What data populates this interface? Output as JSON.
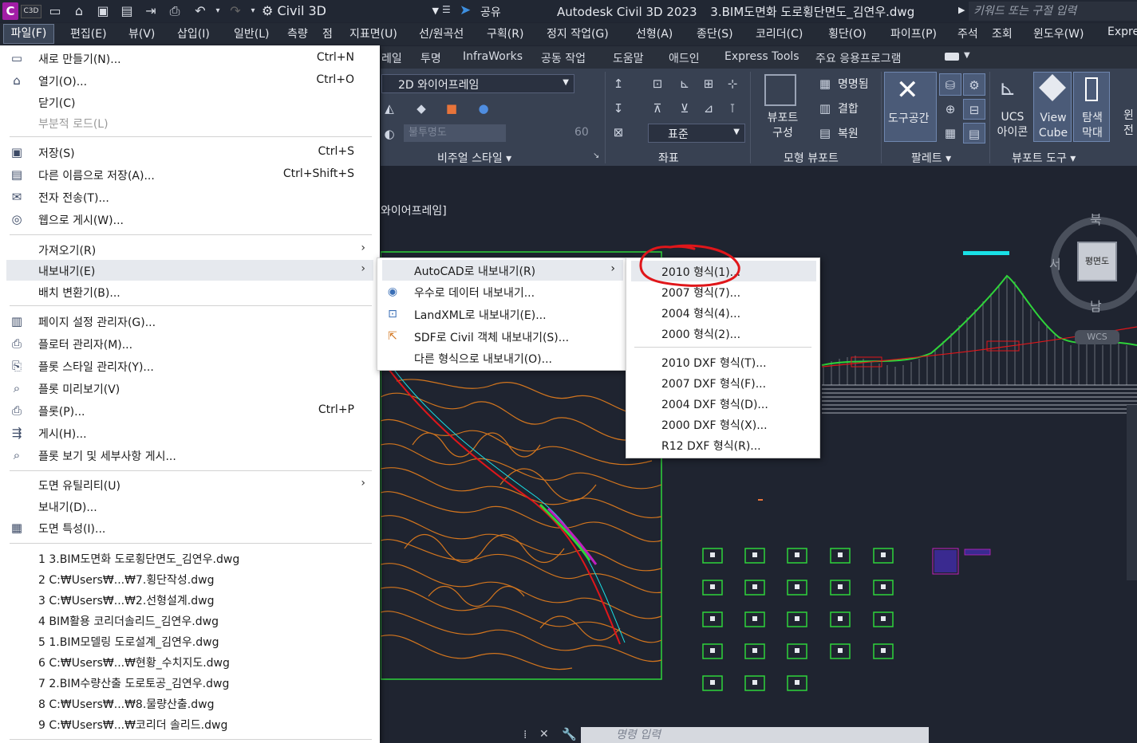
{
  "titlebar": {
    "app_badge": "C",
    "c3d_badge": "C3D",
    "workspace": "Civil 3D",
    "share": "공유",
    "title": "Autodesk Civil 3D 2023",
    "filename": "3.BIM도면화 도로횡단면도_김연우.dwg",
    "search_placeholder": "키워드 또는 구절 입력"
  },
  "menubar": [
    "파일(F)",
    "편집(E)",
    "뷰(V)",
    "삽입(I)",
    "일반(L)",
    "측량",
    "점",
    "지표면(U)",
    "선/원곡선",
    "구획(R)",
    "정지 작업(G)",
    "선형(A)",
    "종단(S)",
    "코리더(C)",
    "횡단(O)",
    "파이프(P)",
    "주석",
    "조회",
    "윈도우(W)",
    "Expre"
  ],
  "ribbon_tabs": [
    "레일",
    "투명",
    "InfraWorks",
    "공동 작업",
    "도움말",
    "애드인",
    "Express Tools",
    "주요 응용프로그램"
  ],
  "ribbon": {
    "visual_style_value": "2D 와이어프레임",
    "transparency_label": "불투명도",
    "transparency_value": "60",
    "coord_value": "표준",
    "viewport_config": "뷰포트 구성",
    "named": "명명됨",
    "join": "결합",
    "restore": "복원",
    "tool_space": "도구공간",
    "ucs_icon": "UCS 아이콘",
    "view_cube": "View Cube",
    "nav_bar": "탐색 막대",
    "win_cut": "윈 전",
    "panels": [
      "비주얼 스타일",
      "좌표",
      "모형 뷰포트",
      "팔레트",
      "뷰포트 도구"
    ]
  },
  "drawing": {
    "viewport_label": "와이어프레임]",
    "compass": {
      "north": "북",
      "west": "서",
      "south": "남",
      "top": "평면도",
      "wcs": "WCS"
    }
  },
  "file_menu": {
    "items": [
      {
        "label": "새로 만들기(N)...",
        "shortcut": "Ctrl+N",
        "icon": "new-icon"
      },
      {
        "label": "열기(O)...",
        "shortcut": "Ctrl+O",
        "icon": "open-icon"
      },
      {
        "label": "닫기(C)",
        "shortcut": "",
        "icon": ""
      },
      {
        "label": "부분적 로드(L)",
        "shortcut": "",
        "icon": "",
        "disabled": true
      },
      {
        "label": "저장(S)",
        "shortcut": "Ctrl+S",
        "icon": "save-icon"
      },
      {
        "label": "다른 이름으로 저장(A)...",
        "shortcut": "Ctrl+Shift+S",
        "icon": "save-as-icon"
      },
      {
        "label": "전자 전송(T)...",
        "shortcut": "",
        "icon": "etransmit-icon"
      },
      {
        "label": "웹으로 게시(W)...",
        "shortcut": "",
        "icon": "publish-web-icon"
      },
      {
        "label": "가져오기(R)",
        "shortcut": "",
        "icon": "",
        "submenu": true
      },
      {
        "label": "내보내기(E)",
        "shortcut": "",
        "icon": "",
        "submenu": true
      },
      {
        "label": "배치 변환기(B)...",
        "shortcut": "",
        "icon": ""
      },
      {
        "label": "페이지 설정 관리자(G)...",
        "shortcut": "",
        "icon": "page-setup-icon"
      },
      {
        "label": "플로터 관리자(M)...",
        "shortcut": "",
        "icon": "plotter-icon"
      },
      {
        "label": "플롯 스타일 관리자(Y)...",
        "shortcut": "",
        "icon": "plot-style-icon"
      },
      {
        "label": "플롯 미리보기(V)",
        "shortcut": "",
        "icon": "plot-preview-icon"
      },
      {
        "label": "플롯(P)...",
        "shortcut": "Ctrl+P",
        "icon": "plot-icon"
      },
      {
        "label": "게시(H)...",
        "shortcut": "",
        "icon": "publish-icon"
      },
      {
        "label": "플롯 보기 및 세부사항 게시...",
        "shortcut": "",
        "icon": "plot-details-icon"
      },
      {
        "label": "도면 유틸리티(U)",
        "shortcut": "",
        "icon": "",
        "submenu": true
      },
      {
        "label": "보내기(D)...",
        "shortcut": "",
        "icon": ""
      },
      {
        "label": "도면 특성(I)...",
        "shortcut": "",
        "icon": "properties-icon"
      }
    ],
    "recent": [
      "1 3.BIM도면화 도로횡단면도_김연우.dwg",
      "2 C:₩Users₩...₩7.횡단작성.dwg",
      "3 C:₩Users₩...₩2.선형설계.dwg",
      "4 BIM활용 코리더솔리드_김연우.dwg",
      "5 1.BIM모델링 도로설계_김연우.dwg",
      "6 C:₩Users₩...₩현황_수치지도.dwg",
      "7 2.BIM수량산출 도로토공_김연우.dwg",
      "8 C:₩Users₩...₩8.물량산출.dwg",
      "9 C:₩Users₩...₩코리더 솔리드.dwg"
    ]
  },
  "export_menu": [
    {
      "label": "AutoCAD로 내보내기(R)",
      "icon": ""
    },
    {
      "label": "우수로 데이터 내보내기...",
      "icon": "storm-icon"
    },
    {
      "label": "LandXML로 내보내기(E)...",
      "icon": "landxml-icon"
    },
    {
      "label": "SDF로 Civil 객체 내보내기(S)...",
      "icon": "sdf-icon"
    },
    {
      "label": "다른 형식으로 내보내기(O)...",
      "icon": ""
    }
  ],
  "autocad_export_menu": {
    "dwg": [
      "2010 형식(1)...",
      "2007 형식(7)...",
      "2004 형식(4)...",
      "2000 형식(2)..."
    ],
    "dxf": [
      "2010 DXF 형식(T)...",
      "2007 DXF 형식(F)...",
      "2004 DXF 형식(D)...",
      "2000 DXF 형식(X)...",
      "R12 DXF 형식(R)..."
    ]
  },
  "command_line": {
    "placeholder": "명령 입력"
  },
  "colors": {
    "accent_red": "#e0161a",
    "terrain_orange": "#d2751e",
    "profile_green": "#2fd43a",
    "cyan": "#19e0e6"
  }
}
